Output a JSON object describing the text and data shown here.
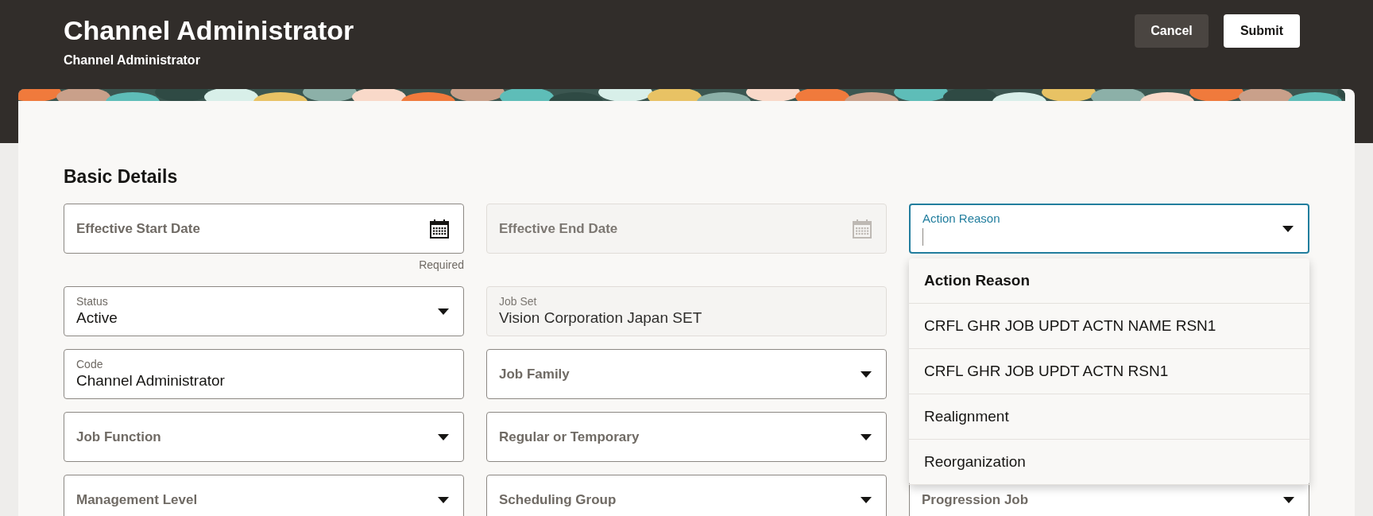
{
  "header": {
    "title": "Channel Administrator",
    "subtitle": "Channel Administrator",
    "buttons": [
      {
        "label": "Cancel",
        "kind": "secondary"
      },
      {
        "label": "Submit",
        "kind": "primary"
      }
    ]
  },
  "section": {
    "title": "Basic Details"
  },
  "rows": [
    [
      {
        "kind": "date",
        "label": "Effective Start Date",
        "disabled": false,
        "focused": false,
        "hint": "Required"
      },
      {
        "kind": "date",
        "label": "Effective End Date",
        "disabled": true,
        "focused": false
      },
      {
        "kind": "select",
        "label": "Action Reason",
        "disabled": false,
        "focused": true,
        "menu": {
          "header": "Action Reason",
          "options": [
            "CRFL GHR JOB UPDT ACTN NAME RSN1",
            "CRFL GHR JOB UPDT ACTN RSN1",
            "Realignment",
            "Reorganization"
          ]
        }
      }
    ],
    [
      {
        "kind": "select",
        "label": "Status",
        "value": "Active",
        "disabled": false,
        "focused": false
      },
      {
        "kind": "text",
        "label": "Job Set",
        "value": "Vision Corporation Japan SET",
        "disabled": true,
        "focused": false
      }
    ],
    [
      {
        "kind": "text",
        "label": "Code",
        "value": "Channel Administrator",
        "disabled": false,
        "focused": false
      },
      {
        "kind": "select",
        "label": "Job Family",
        "disabled": false,
        "focused": false
      }
    ],
    [
      {
        "kind": "select",
        "label": "Job Function",
        "disabled": false,
        "focused": false
      },
      {
        "kind": "select",
        "label": "Regular or Temporary",
        "disabled": false,
        "focused": false
      }
    ],
    [
      {
        "kind": "select",
        "label": "Management Level",
        "disabled": false,
        "focused": false
      },
      {
        "kind": "select",
        "label": "Scheduling Group",
        "disabled": false,
        "focused": false
      },
      {
        "kind": "select",
        "label": "Progression Job",
        "disabled": false,
        "focused": false
      }
    ]
  ]
}
